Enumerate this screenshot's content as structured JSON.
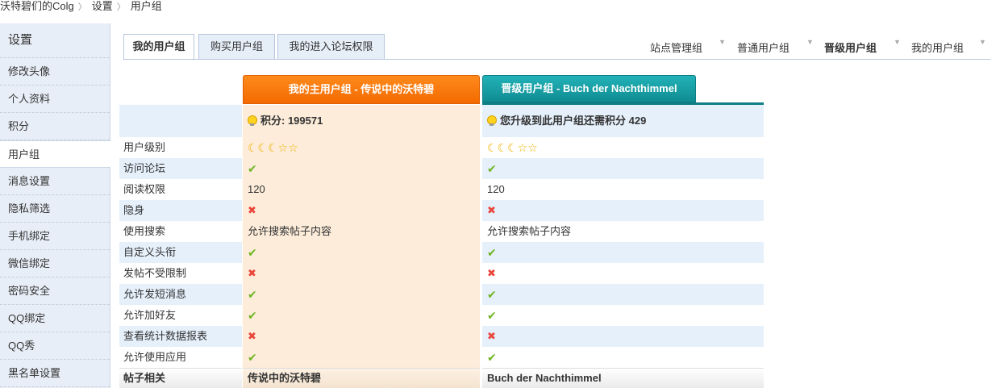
{
  "breadcrumb": {
    "items": [
      "沃特碧们的Colg",
      "设置",
      "用户组"
    ],
    "separator": "〉"
  },
  "sidebar": {
    "title": "设置",
    "items": [
      {
        "label": "修改头像",
        "active": false
      },
      {
        "label": "个人资料",
        "active": false
      },
      {
        "label": "积分",
        "active": false
      },
      {
        "label": "用户组",
        "active": true
      },
      {
        "label": "消息设置",
        "active": false
      },
      {
        "label": "隐私筛选",
        "active": false
      },
      {
        "label": "手机绑定",
        "active": false
      },
      {
        "label": "微信绑定",
        "active": false
      },
      {
        "label": "密码安全",
        "active": false
      },
      {
        "label": "QQ绑定",
        "active": false
      },
      {
        "label": "QQ秀",
        "active": false
      },
      {
        "label": "黑名单设置",
        "active": false
      }
    ]
  },
  "tabs": [
    {
      "label": "我的用户组",
      "active": true
    },
    {
      "label": "购买用户组",
      "active": false
    },
    {
      "label": "我的进入论坛权限",
      "active": false
    }
  ],
  "right_tabs": [
    {
      "label": "站点管理组",
      "bold": false
    },
    {
      "label": "普通用户组",
      "bold": false
    },
    {
      "label": "晋级用户组",
      "bold": true
    },
    {
      "label": "我的用户组",
      "bold": false
    }
  ],
  "columns": {
    "main_header": "我的主用户组 - 传说中的沃特碧",
    "next_header": "晋级用户组 - Buch der Nachthimmel",
    "main_points": "积分: 199571",
    "next_points": "您升级到此用户组还需积分 429"
  },
  "rows": [
    {
      "label": "用户级别",
      "main": "level",
      "next": "level"
    },
    {
      "label": "访问论坛",
      "main": "yes",
      "next": "yes"
    },
    {
      "label": "阅读权限",
      "main": "120",
      "next": "120"
    },
    {
      "label": "隐身",
      "main": "no",
      "next": "no"
    },
    {
      "label": "使用搜索",
      "main": "允许搜索帖子内容",
      "next": "允许搜索帖子内容"
    },
    {
      "label": "自定义头衔",
      "main": "yes",
      "next": "yes"
    },
    {
      "label": "发帖不受限制",
      "main": "no",
      "next": "no"
    },
    {
      "label": "允许发短消息",
      "main": "yes",
      "next": "yes"
    },
    {
      "label": "允许加好友",
      "main": "yes",
      "next": "yes"
    },
    {
      "label": "查看统计数据报表",
      "main": "no",
      "next": "no"
    },
    {
      "label": "允许使用应用",
      "main": "yes",
      "next": "yes"
    }
  ],
  "footer": {
    "label": "帖子相关",
    "main": "传说中的沃特碧",
    "next": "Buch der Nachthimmel"
  },
  "icons": {
    "yes": "✔",
    "no": "✖",
    "level": "☾☾☾☆☆",
    "bulb": "bulb-icon",
    "dropdown": "▼"
  },
  "colors": {
    "main_header": "#f36a00",
    "next_header": "#0f8c92",
    "check": "#6fb523",
    "cross": "#e8463a",
    "level_star": "#f2b200"
  }
}
